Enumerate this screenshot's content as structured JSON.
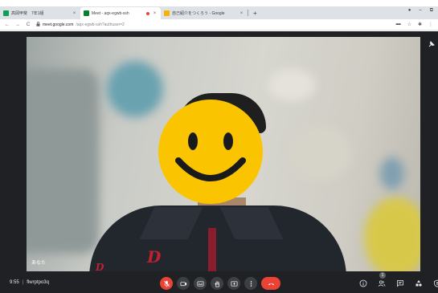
{
  "browser": {
    "tabs": [
      {
        "title": "高岡甲斐　7年1組",
        "favicon_color": "#0f9d58",
        "active": false
      },
      {
        "title": "Meet - aqx-egwb-ssh",
        "favicon_color": "#00832d",
        "active": true,
        "recording": true
      },
      {
        "title": "自己紹介をつくろう - Google",
        "favicon_color": "#f4b400",
        "active": false
      }
    ],
    "new_tab": "+",
    "close_glyph": "×",
    "window_controls": [
      "●",
      "–",
      "⧉"
    ],
    "nav": [
      "←",
      "→",
      "C"
    ],
    "url_domain": "meet.google.com",
    "url_path": "/aqx-egwb-ssh?authuser=2",
    "toolbar_icons": [
      "▬",
      "☆",
      "✱",
      "⋮"
    ]
  },
  "meet": {
    "participant_name": "あなた",
    "time": "9:55",
    "meeting_code": "flwrptpo3q",
    "separator": "|",
    "people_count": "1",
    "colors": {
      "background": "#202124",
      "red": "#ea4335",
      "button": "#3c4043",
      "smiley": "#fbc400"
    },
    "controls": [
      {
        "name": "mic-off-icon",
        "state": "off"
      },
      {
        "name": "camera-icon"
      },
      {
        "name": "captions-icon"
      },
      {
        "name": "raise-hand-icon"
      },
      {
        "name": "present-icon"
      },
      {
        "name": "more-options-icon"
      },
      {
        "name": "end-call-icon"
      }
    ],
    "right_controls": [
      "info-icon",
      "people-icon",
      "chat-icon",
      "activities-icon",
      "host-controls-icon"
    ]
  }
}
